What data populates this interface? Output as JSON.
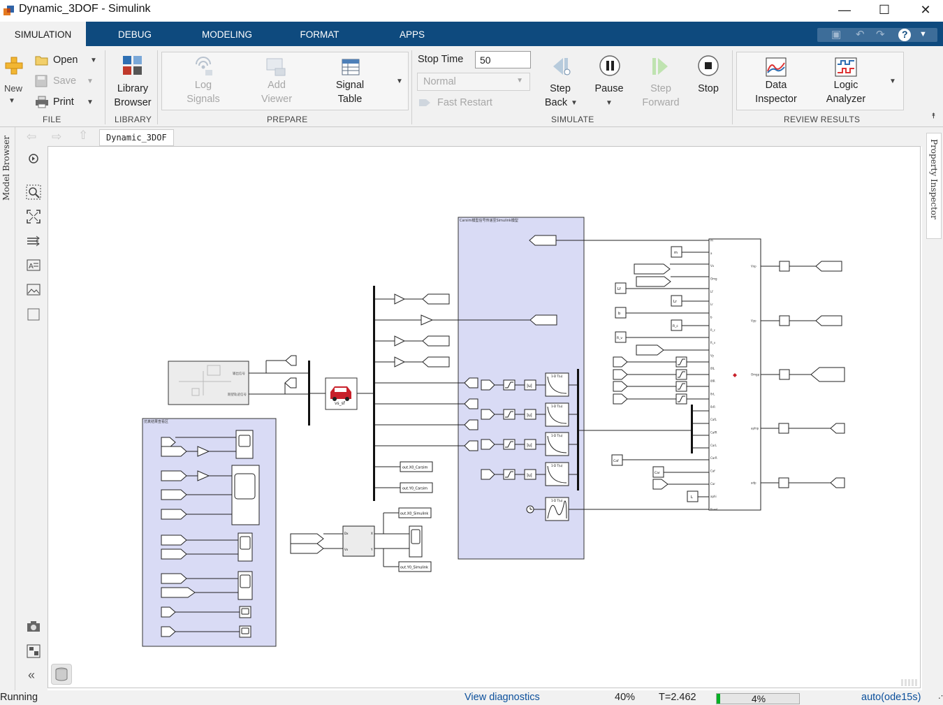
{
  "window": {
    "title": "Dynamic_3DOF - Simulink",
    "controls": {
      "minimize": "—",
      "maximize": "☐",
      "close": "✕"
    }
  },
  "ribbon_tabs": [
    "SIMULATION",
    "DEBUG",
    "MODELING",
    "FORMAT",
    "APPS"
  ],
  "ribbon": {
    "file": {
      "new": "New",
      "open": "Open",
      "save": "Save",
      "print": "Print",
      "group": "FILE"
    },
    "library": {
      "line1": "Library",
      "line2": "Browser",
      "group": "LIBRARY"
    },
    "prepare": {
      "log1": "Log",
      "log2": "Signals",
      "add1": "Add",
      "add2": "Viewer",
      "sig1": "Signal",
      "sig2": "Table",
      "group": "PREPARE"
    },
    "simulate": {
      "stop_time_label": "Stop Time",
      "stop_time_value": "50",
      "mode": "Normal",
      "fast_restart": "Fast Restart",
      "step_back1": "Step",
      "step_back2": "Back",
      "pause": "Pause",
      "step_fwd1": "Step",
      "step_fwd2": "Forward",
      "stop": "Stop",
      "group": "SIMULATE"
    },
    "review": {
      "di1": "Data",
      "di2": "Inspector",
      "la1": "Logic",
      "la2": "Analyzer",
      "group": "REVIEW RESULTS"
    }
  },
  "docks": {
    "left": "Model Browser",
    "right": "Property Inspector"
  },
  "breadcrumb": "Dynamic_3DOF",
  "model": {
    "carsim_area_title": "Carsim模型信号传递至Simulink模型",
    "results_area_title": "仿真结果查看区",
    "vehicle_block_label": "vs_sf",
    "goto_labels": {
      "x0_carsim": "out.X0_Carsim",
      "y0_carsim": "out.Y0_Carsim",
      "x0_simulink": "out.X0_Simulink",
      "y0_simulink": "out.Y0_Simulink"
    },
    "subsystem_ports": {
      "inputs": [
        "m",
        "a",
        "Vx",
        "Omg",
        "Lf",
        "Lr",
        "b",
        "R_c",
        "R_v",
        "Vy",
        "δfL",
        "δfR",
        "δrL",
        "δrR",
        "CafL",
        "CafR",
        "CarL",
        "CarR",
        "Caf",
        "Car",
        "aphi",
        "Ksasl"
      ],
      "outputs": [
        "Vxp",
        "Vyp",
        "Omgp",
        "aphip",
        "adp"
      ]
    },
    "constants": [
      "m",
      "Lf",
      "Lr",
      "b",
      "R_c",
      "R_v",
      "Caf",
      "Car",
      "L"
    ],
    "tf_label": "1-D T(u)",
    "abs_label": "|u|",
    "mini_sub_ports": [
      "输出信号",
      "期望轨迹信号"
    ],
    "small_sub_ports": {
      "in1": "Dx",
      "in2": "Vx",
      "out1": "X",
      "out2": "Y"
    },
    "car_icon_color": "#c8202a"
  },
  "status": {
    "state": "Running",
    "diagnostics": "View diagnostics",
    "zoom": "40%",
    "time": "T=2.462",
    "progress_label": "4%",
    "progress_fraction": 0.04,
    "solver": "auto(ode15s)"
  },
  "colors": {
    "accent": "#0e4a7e",
    "area_fill": "#d9dbf5",
    "progress": "#06b025"
  }
}
